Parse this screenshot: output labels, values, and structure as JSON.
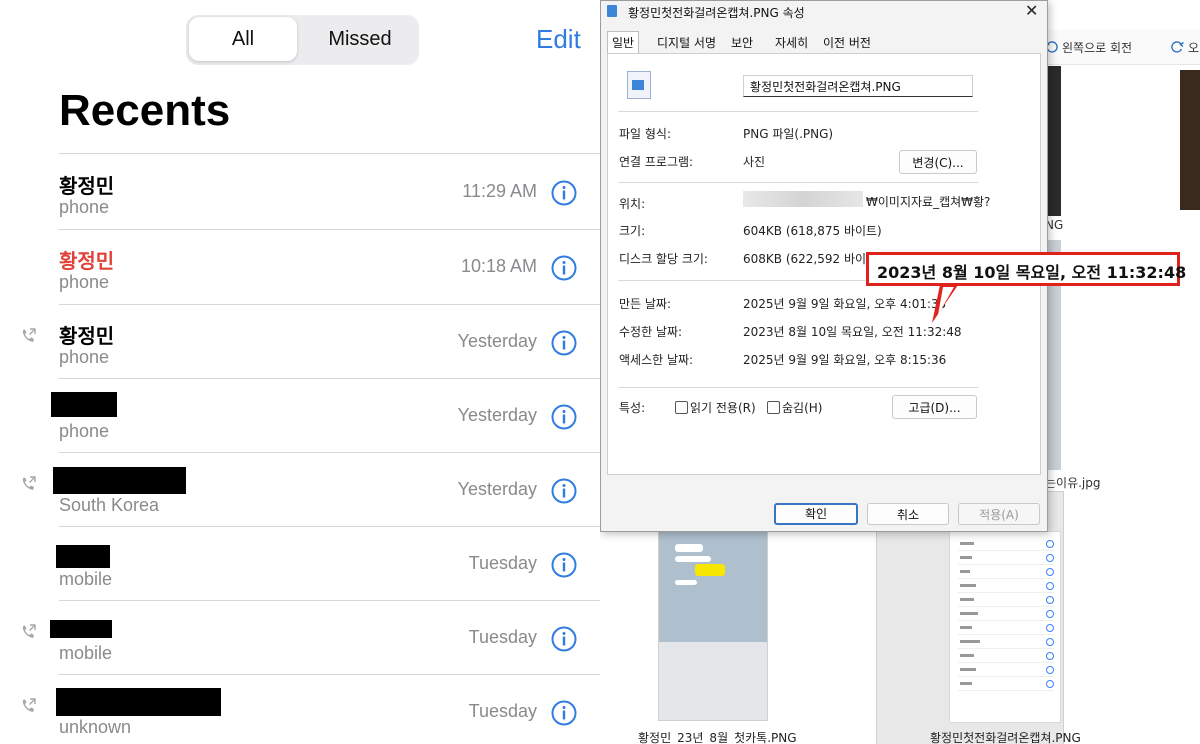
{
  "ios": {
    "segments": [
      "All",
      "Missed"
    ],
    "edit_label": "Edit",
    "title": "Recents",
    "rows": [
      {
        "name": "황정민",
        "sub": "phone",
        "time": "11:29 AM",
        "missed": false,
        "outgoing": false
      },
      {
        "name": "황정민",
        "sub": "phone",
        "time": "10:18 AM",
        "missed": true,
        "outgoing": false
      },
      {
        "name": "황정민",
        "sub": "phone",
        "time": "Yesterday",
        "missed": false,
        "outgoing": true
      },
      {
        "name": "",
        "sub": "phone",
        "time": "Yesterday",
        "missed": false,
        "outgoing": false
      },
      {
        "name": "",
        "sub": "South Korea",
        "time": "Yesterday",
        "missed": false,
        "outgoing": true
      },
      {
        "name": "",
        "sub": "mobile",
        "time": "Tuesday",
        "missed": false,
        "outgoing": false
      },
      {
        "name": "",
        "sub": "mobile",
        "time": "Tuesday",
        "missed": false,
        "outgoing": true
      },
      {
        "name": "",
        "sub": "unknown",
        "time": "Tuesday",
        "missed": false,
        "outgoing": true
      }
    ],
    "colors": {
      "accent": "#2f7de1",
      "missed": "#e0423a",
      "secondary": "#8a8a8e"
    }
  },
  "explorer": {
    "toolbar_rotate_left": "왼쪽으로 회전",
    "toolbar_rotate_right": "오",
    "cut_label_1": "NG",
    "cut_label_2": "는이유.jpg",
    "thumb1_label": "황정민_23년_8월_첫카톡.PNG",
    "thumb2_label": "황정민첫전화걸려온캡쳐.PNG"
  },
  "dialog": {
    "title": "황정민첫전화걸려온캡쳐.PNG 속성",
    "close": "✕",
    "tabs": [
      "일반",
      "디지털 서명",
      "보안",
      "자세히",
      "이전 버전"
    ],
    "filename": "황정민첫전화걸려온캡쳐.PNG",
    "fields": {
      "type_label": "파일 형식:",
      "type_value": "PNG 파일(.PNG)",
      "open_label": "연결 프로그램:",
      "open_value": "사진",
      "change_btn": "변경(C)...",
      "location_label": "위치:",
      "location_value": "₩이미지자료_캡쳐₩황?",
      "size_label": "크기:",
      "size_value": "604KB (618,875 바이트)",
      "disk_label": "디스크 할당 크기:",
      "disk_value": "608KB (622,592 바이트)",
      "created_label": "만든 날짜:",
      "created_value": "2025년 9월 9일 화요일, 오후 4:01:35",
      "modified_label": "수정한 날짜:",
      "modified_value": "2023년 8월 10일 목요일, 오전 11:32:48",
      "accessed_label": "액세스한 날짜:",
      "accessed_value": "2025년 9월 9일 화요일, 오후 8:15:36",
      "attr_label": "특성:",
      "readonly_label": "읽기 전용(R)",
      "hidden_label": "숨김(H)",
      "advanced_btn": "고급(D)..."
    },
    "buttons": {
      "ok": "확인",
      "cancel": "취소",
      "apply": "적용(A)"
    },
    "callout": "2023년 8월 10일 목요일, 오전 11:32:48",
    "callout_color": "#e0211c"
  }
}
